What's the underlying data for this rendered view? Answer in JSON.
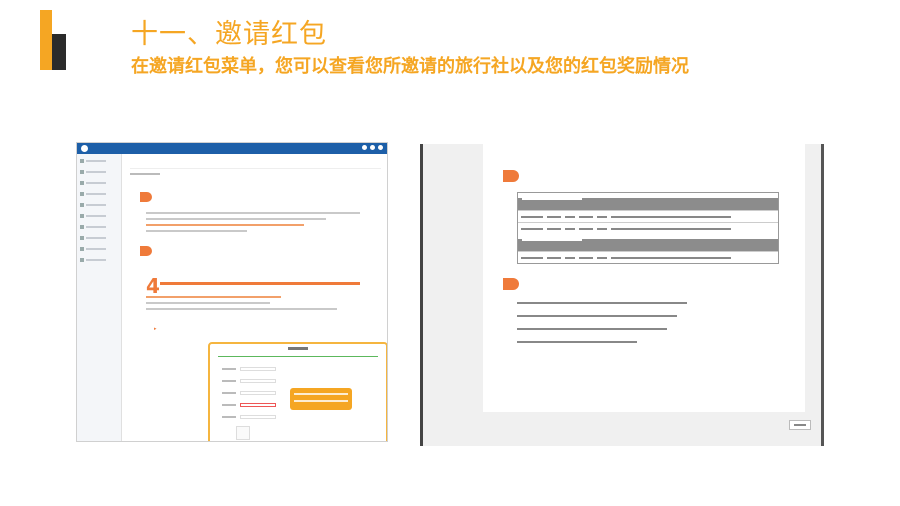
{
  "slide": {
    "title": "十一、邀请红包",
    "subtitle": "在邀请红包菜单，您可以查看您所邀请的旅行社以及您的红包奖励情况"
  },
  "colors": {
    "accent": "#F5A623",
    "dark": "#2b2b2b",
    "tag": "#ef7a3a",
    "app_header": "#1d5fa8"
  },
  "left_screenshot": {
    "icons": [
      "logo-icon",
      "menu-icon"
    ]
  },
  "right_screenshot": {
    "icons": [
      "close-icon"
    ]
  }
}
